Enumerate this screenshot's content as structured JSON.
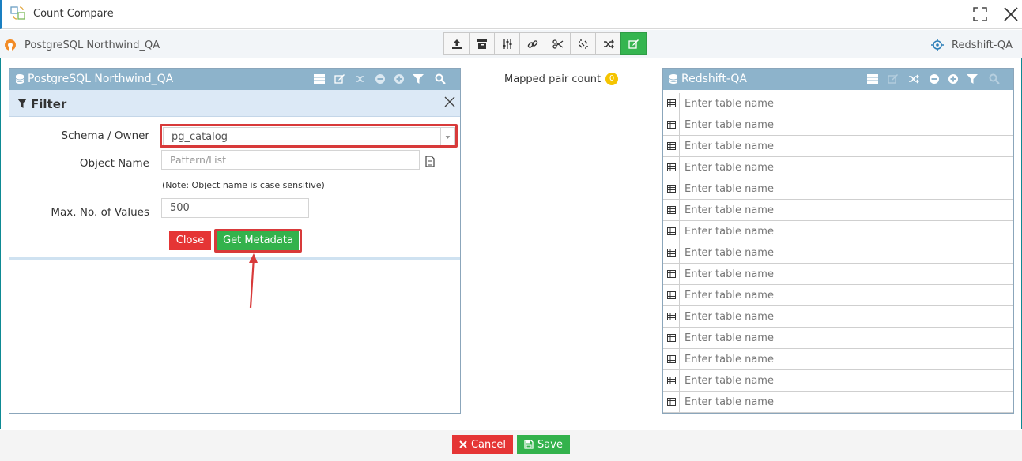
{
  "window": {
    "title": "Count Compare"
  },
  "connections": {
    "source": "PostgreSQL Northwind_QA",
    "target": "Redshift-QA"
  },
  "toolbar": {
    "buttons": [
      {
        "icon": "upload-icon"
      },
      {
        "icon": "archive-icon"
      },
      {
        "icon": "sliders-icon"
      },
      {
        "icon": "link-icon"
      },
      {
        "icon": "scissors-icon"
      },
      {
        "icon": "unlink-icon"
      },
      {
        "icon": "shuffle-icon"
      },
      {
        "icon": "edit-icon",
        "active": true
      }
    ]
  },
  "left_panel": {
    "title": "PostgreSQL Northwind_QA",
    "filter": {
      "title": "Filter",
      "schema_label": "Schema / Owner",
      "schema_value": "pg_catalog",
      "object_label": "Object Name",
      "object_placeholder": "Pattern/List",
      "note": "(Note: Object name is case sensitive)",
      "max_label": "Max. No. of Values",
      "max_value": "500",
      "close_label": "Close",
      "get_metadata_label": "Get Metadata"
    }
  },
  "mapped": {
    "label": "Mapped pair count",
    "count": "0"
  },
  "right_panel": {
    "title": "Redshift-QA",
    "rows": [
      "Enter table name",
      "Enter table name",
      "Enter table name",
      "Enter table name",
      "Enter table name",
      "Enter table name",
      "Enter table name",
      "Enter table name",
      "Enter table name",
      "Enter table name",
      "Enter table name",
      "Enter table name",
      "Enter table name",
      "Enter table name",
      "Enter table name"
    ]
  },
  "footer": {
    "cancel_label": "Cancel",
    "save_label": "Save"
  },
  "colors": {
    "accent": "#1a7fc1",
    "panel_header": "#8db3cb",
    "green": "#33b24c",
    "red": "#e53535",
    "highlight": "#d83a3a"
  }
}
